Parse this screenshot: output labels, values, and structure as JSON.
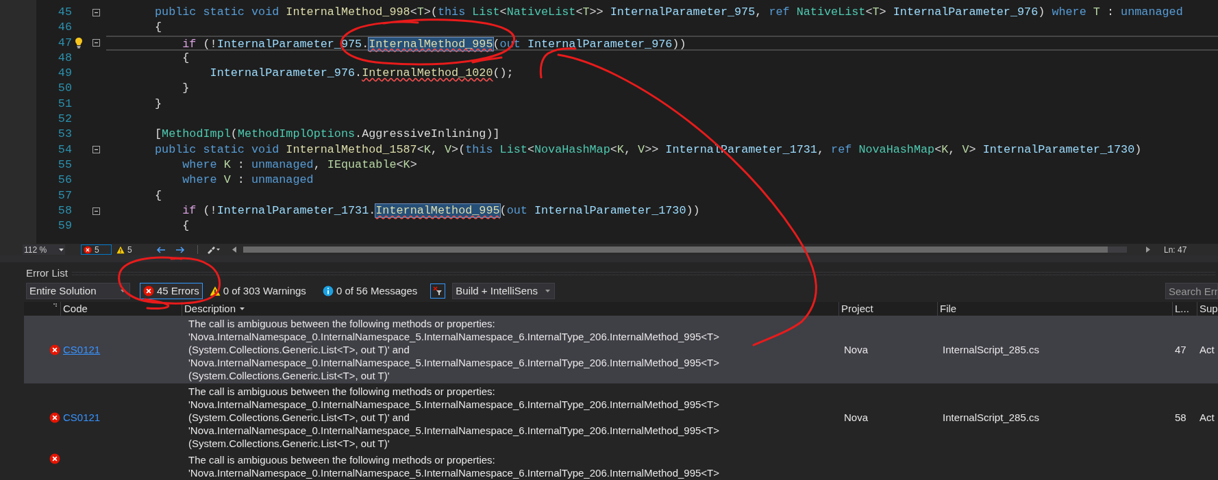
{
  "editor": {
    "lines": [
      {
        "number": "45",
        "foldable": true,
        "lightbulb": false,
        "current": false,
        "tokens": [
          {
            "text": "public static void ",
            "kind": "keyword"
          },
          {
            "text": "InternalMethod_998",
            "kind": "method"
          },
          {
            "text": "<",
            "kind": "plain"
          },
          {
            "text": "T",
            "kind": "typeparam"
          },
          {
            "text": ">(",
            "kind": "plain"
          },
          {
            "text": "this ",
            "kind": "keyword"
          },
          {
            "text": "List",
            "kind": "type"
          },
          {
            "text": "<",
            "kind": "plain"
          },
          {
            "text": "NativeList",
            "kind": "type"
          },
          {
            "text": "<",
            "kind": "plain"
          },
          {
            "text": "T",
            "kind": "typeparam"
          },
          {
            "text": ">> ",
            "kind": "plain"
          },
          {
            "text": "InternalParameter_975",
            "kind": "param"
          },
          {
            "text": ", ",
            "kind": "plain"
          },
          {
            "text": "ref ",
            "kind": "keyword"
          },
          {
            "text": "NativeList",
            "kind": "type"
          },
          {
            "text": "<",
            "kind": "plain"
          },
          {
            "text": "T",
            "kind": "typeparam"
          },
          {
            "text": "> ",
            "kind": "plain"
          },
          {
            "text": "InternalParameter_976",
            "kind": "param"
          },
          {
            "text": ") ",
            "kind": "plain"
          },
          {
            "text": "where ",
            "kind": "keyword"
          },
          {
            "text": "T",
            "kind": "typeparam"
          },
          {
            "text": " : ",
            "kind": "plain"
          },
          {
            "text": "unmanaged",
            "kind": "keyword"
          }
        ]
      },
      {
        "number": "46",
        "foldable": false,
        "lightbulb": false,
        "current": false,
        "tokens": [
          {
            "text": "{",
            "kind": "plain"
          }
        ]
      },
      {
        "number": "47",
        "foldable": true,
        "lightbulb": true,
        "current": true,
        "tokens": [
          {
            "text": "    if ",
            "kind": "control"
          },
          {
            "text": "(!",
            "kind": "plain"
          },
          {
            "text": "InternalParameter_975",
            "kind": "param"
          },
          {
            "text": ".",
            "kind": "plain"
          },
          {
            "text": "InternalMethod_995",
            "kind": "match"
          },
          {
            "text": "(",
            "kind": "plain"
          },
          {
            "text": "out ",
            "kind": "keyword"
          },
          {
            "text": "InternalParameter_976",
            "kind": "param"
          },
          {
            "text": "))",
            "kind": "plain"
          }
        ]
      },
      {
        "number": "48",
        "foldable": false,
        "lightbulb": false,
        "current": false,
        "tokens": [
          {
            "text": "    {",
            "kind": "plain"
          }
        ]
      },
      {
        "number": "49",
        "foldable": false,
        "lightbulb": false,
        "current": false,
        "tokens": [
          {
            "text": "        InternalParameter_976",
            "kind": "param"
          },
          {
            "text": ".",
            "kind": "plain"
          },
          {
            "text": "InternalMethod_1020",
            "kind": "error"
          },
          {
            "text": "();",
            "kind": "plain"
          }
        ]
      },
      {
        "number": "50",
        "foldable": false,
        "lightbulb": false,
        "current": false,
        "tokens": [
          {
            "text": "    }",
            "kind": "plain"
          }
        ]
      },
      {
        "number": "51",
        "foldable": false,
        "lightbulb": false,
        "current": false,
        "tokens": [
          {
            "text": "}",
            "kind": "plain"
          }
        ]
      },
      {
        "number": "52",
        "foldable": false,
        "lightbulb": false,
        "current": false
      },
      {
        "number": "53",
        "foldable": false,
        "lightbulb": false,
        "current": false,
        "tokens": [
          {
            "text": "[",
            "kind": "plain"
          },
          {
            "text": "MethodImpl",
            "kind": "type"
          },
          {
            "text": "(",
            "kind": "plain"
          },
          {
            "text": "MethodImplOptions",
            "kind": "type"
          },
          {
            "text": ".AggressiveInlining)]",
            "kind": "plain"
          }
        ]
      },
      {
        "number": "54",
        "foldable": true,
        "lightbulb": false,
        "current": false,
        "tokens": [
          {
            "text": "public static void ",
            "kind": "keyword"
          },
          {
            "text": "InternalMethod_1587",
            "kind": "method"
          },
          {
            "text": "<",
            "kind": "plain"
          },
          {
            "text": "K",
            "kind": "typeparam"
          },
          {
            "text": ", ",
            "kind": "plain"
          },
          {
            "text": "V",
            "kind": "typeparam"
          },
          {
            "text": ">(",
            "kind": "plain"
          },
          {
            "text": "this ",
            "kind": "keyword"
          },
          {
            "text": "List",
            "kind": "type"
          },
          {
            "text": "<",
            "kind": "plain"
          },
          {
            "text": "NovaHashMap",
            "kind": "type"
          },
          {
            "text": "<",
            "kind": "plain"
          },
          {
            "text": "K",
            "kind": "typeparam"
          },
          {
            "text": ", ",
            "kind": "plain"
          },
          {
            "text": "V",
            "kind": "typeparam"
          },
          {
            "text": ">> ",
            "kind": "plain"
          },
          {
            "text": "InternalParameter_1731",
            "kind": "param"
          },
          {
            "text": ", ",
            "kind": "plain"
          },
          {
            "text": "ref ",
            "kind": "keyword"
          },
          {
            "text": "NovaHashMap",
            "kind": "type"
          },
          {
            "text": "<",
            "kind": "plain"
          },
          {
            "text": "K",
            "kind": "typeparam"
          },
          {
            "text": ", ",
            "kind": "plain"
          },
          {
            "text": "V",
            "kind": "typeparam"
          },
          {
            "text": "> ",
            "kind": "plain"
          },
          {
            "text": "InternalParameter_1730",
            "kind": "param"
          },
          {
            "text": ")",
            "kind": "plain"
          }
        ]
      },
      {
        "number": "55",
        "foldable": false,
        "lightbulb": false,
        "current": false,
        "tokens": [
          {
            "text": "    where ",
            "kind": "keyword"
          },
          {
            "text": "K",
            "kind": "typeparam"
          },
          {
            "text": " : ",
            "kind": "plain"
          },
          {
            "text": "unmanaged",
            "kind": "keyword"
          },
          {
            "text": ", ",
            "kind": "plain"
          },
          {
            "text": "IEquatable",
            "kind": "typeparam"
          },
          {
            "text": "<",
            "kind": "plain"
          },
          {
            "text": "K",
            "kind": "typeparam"
          },
          {
            "text": ">",
            "kind": "plain"
          }
        ]
      },
      {
        "number": "56",
        "foldable": false,
        "lightbulb": false,
        "current": false,
        "tokens": [
          {
            "text": "    where ",
            "kind": "keyword"
          },
          {
            "text": "V",
            "kind": "typeparam"
          },
          {
            "text": " : ",
            "kind": "plain"
          },
          {
            "text": "unmanaged",
            "kind": "keyword"
          }
        ]
      },
      {
        "number": "57",
        "foldable": false,
        "lightbulb": false,
        "current": false,
        "tokens": [
          {
            "text": "{",
            "kind": "plain"
          }
        ]
      },
      {
        "number": "58",
        "foldable": true,
        "lightbulb": false,
        "current": false,
        "tokens": [
          {
            "text": "    if ",
            "kind": "control"
          },
          {
            "text": "(!",
            "kind": "plain"
          },
          {
            "text": "InternalParameter_1731",
            "kind": "param"
          },
          {
            "text": ".",
            "kind": "plain"
          },
          {
            "text": "InternalMethod_995",
            "kind": "match"
          },
          {
            "text": "(",
            "kind": "plain"
          },
          {
            "text": "out ",
            "kind": "keyword"
          },
          {
            "text": "InternalParameter_1730",
            "kind": "param"
          },
          {
            "text": "))",
            "kind": "plain"
          }
        ]
      },
      {
        "number": "59",
        "foldable": false,
        "lightbulb": false,
        "current": false,
        "tokens": [
          {
            "text": "    {",
            "kind": "plain"
          }
        ]
      }
    ],
    "status": {
      "zoom": "112 %",
      "errors": "5",
      "warnings": "5",
      "position": "Ln: 47"
    }
  },
  "error_list": {
    "title": "Error List",
    "scope": "Entire Solution",
    "filters": [
      {
        "kind": "errors",
        "label": "45 Errors",
        "selected": true
      },
      {
        "kind": "warnings",
        "label": "0 of 303 Warnings",
        "selected": false
      },
      {
        "kind": "messages",
        "label": "0 of 56 Messages",
        "selected": false
      }
    ],
    "filter_toggle": {
      "on": true
    },
    "source": "Build + IntelliSens",
    "search": {
      "placeholder": "Search Err"
    },
    "columns": [
      "Code",
      "Description",
      "Project",
      "File",
      "L...",
      "Sup"
    ],
    "rows": [
      {
        "selected": true,
        "code": "CS0121",
        "description": [
          "The call is ambiguous between the following methods or properties:",
          "'Nova.InternalNamespace_0.InternalNamespace_5.InternalNamespace_6.InternalType_206.InternalMethod_995<T>",
          "(System.Collections.Generic.List<T>, out T)' and",
          "'Nova.InternalNamespace_0.InternalNamespace_5.InternalNamespace_6.InternalType_206.InternalMethod_995<T>",
          "(System.Collections.Generic.List<T>, out T)'"
        ],
        "project": "Nova",
        "file": "InternalScript_285.cs",
        "line": "47",
        "suppression": "Act"
      },
      {
        "selected": false,
        "code": "CS0121",
        "description": [
          "The call is ambiguous between the following methods or properties:",
          "'Nova.InternalNamespace_0.InternalNamespace_5.InternalNamespace_6.InternalType_206.InternalMethod_995<T>",
          "(System.Collections.Generic.List<T>, out T)' and",
          "'Nova.InternalNamespace_0.InternalNamespace_5.InternalNamespace_6.InternalType_206.InternalMethod_995<T>",
          "(System.Collections.Generic.List<T>, out T)'"
        ],
        "project": "Nova",
        "file": "InternalScript_285.cs",
        "line": "58",
        "suppression": "Act"
      },
      {
        "selected": false,
        "description": [
          "The call is ambiguous between the following methods or properties:",
          "'Nova.InternalNamespace_0.InternalNamespace_5.InternalNamespace_6.InternalType_206.InternalMethod_995<T>"
        ]
      }
    ]
  }
}
